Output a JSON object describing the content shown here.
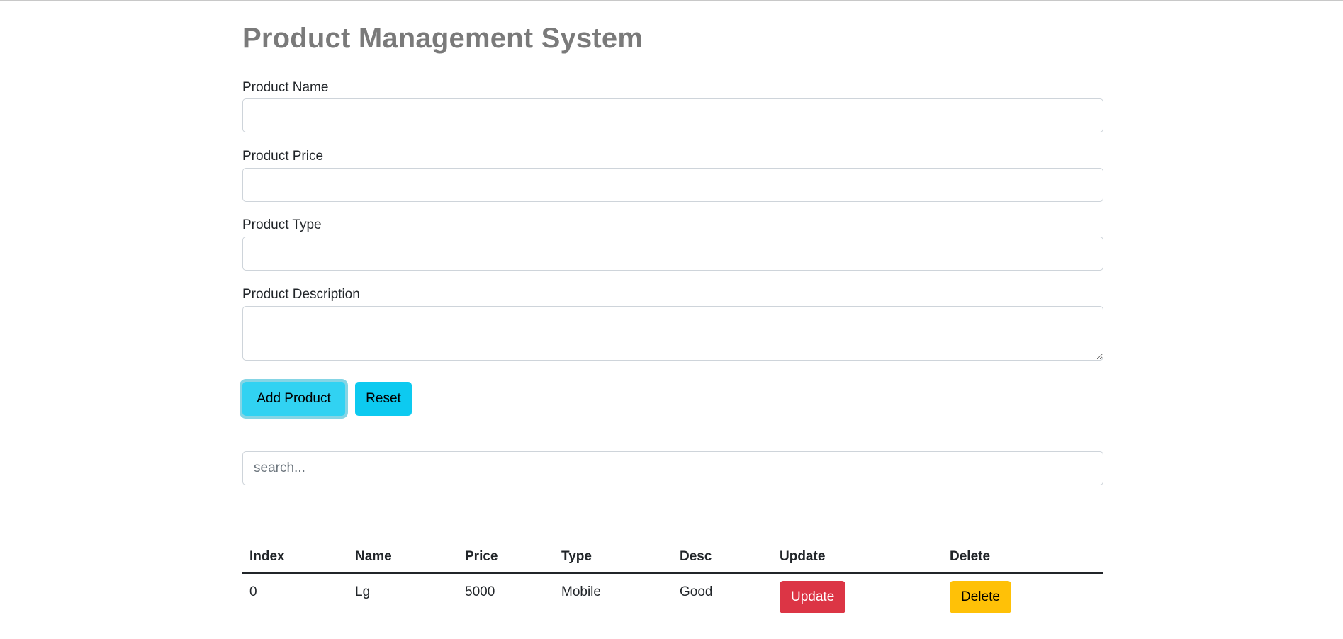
{
  "header": {
    "title": "Product Management System"
  },
  "form": {
    "name_label": "Product Name",
    "name_value": "",
    "price_label": "Product Price",
    "price_value": "",
    "type_label": "Product Type",
    "type_value": "",
    "desc_label": "Product Description",
    "desc_value": "",
    "add_label": "Add Product",
    "reset_label": "Reset"
  },
  "search": {
    "placeholder": "search...",
    "value": ""
  },
  "table": {
    "headers": [
      "Index",
      "Name",
      "Price",
      "Type",
      "Desc",
      "Update",
      "Delete"
    ],
    "rows": [
      {
        "index": "0",
        "name": "Lg",
        "price": "5000",
        "type": "Mobile",
        "desc": "Good",
        "update_label": "Update",
        "delete_label": "Delete"
      }
    ]
  },
  "colors": {
    "title": "#7a7a7a",
    "info": "#0dcaf0",
    "info_active": "#31d2f2",
    "danger": "#dc3545",
    "warning": "#ffc107"
  }
}
